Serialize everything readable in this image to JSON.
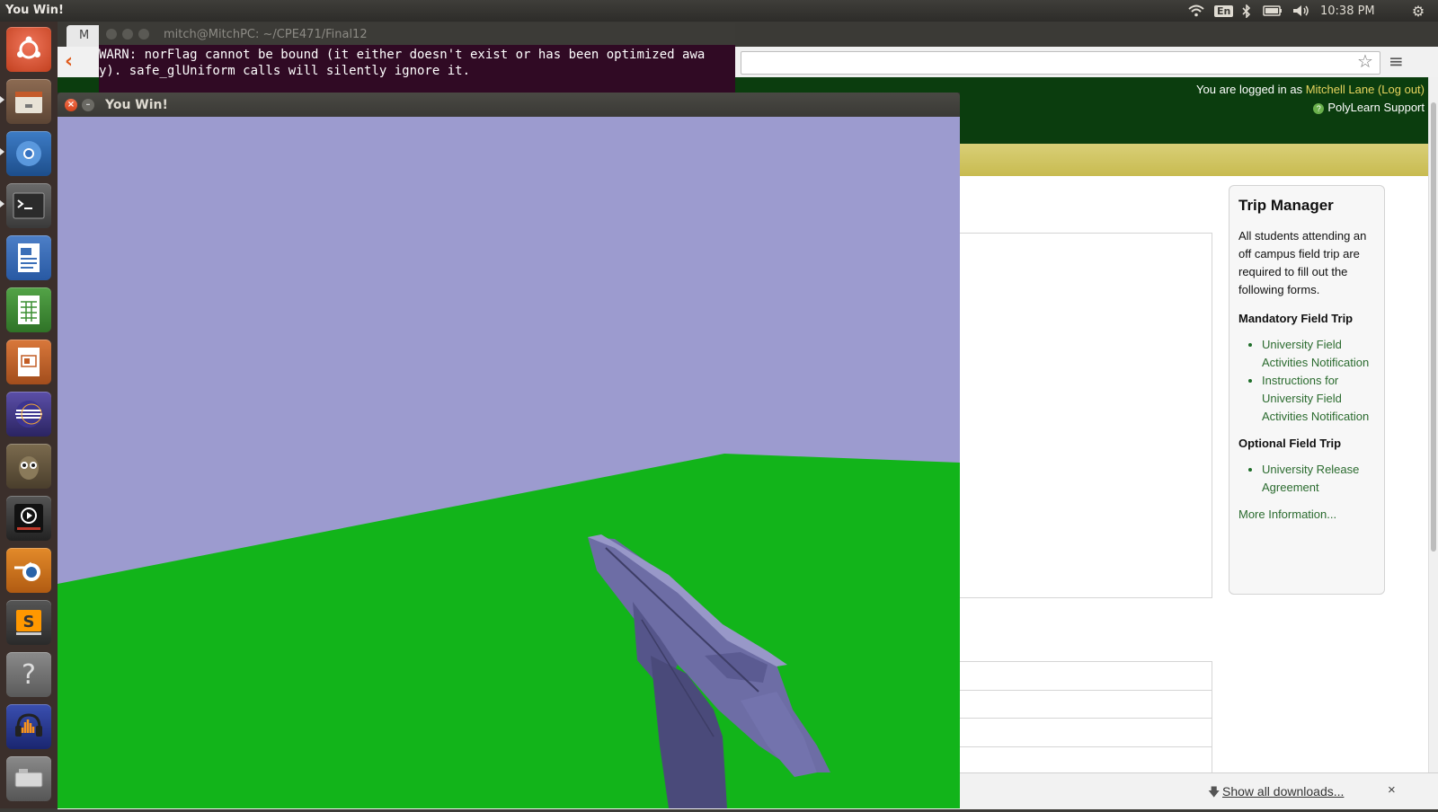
{
  "topbar": {
    "title": "You Win!",
    "language": "En",
    "time": "10:38 PM",
    "icons": [
      "wifi-icon",
      "bluetooth-icon",
      "battery-icon",
      "volume-icon",
      "gear-icon"
    ]
  },
  "launcher": {
    "items": [
      "ubuntu-dash",
      "files",
      "chromium",
      "terminal",
      "writer",
      "calc",
      "impress",
      "eclipse",
      "gimp",
      "video-player",
      "blender",
      "sublime-text",
      "help",
      "audacity",
      "removable-drive"
    ]
  },
  "terminal": {
    "title": "mitch@MitchPC: ~/CPE471/Final12",
    "line1": "WARN: norFlag cannot be bound (it either doesn't exist or has been optimized awa",
    "line2": "y). safe_glUniform calls will silently ignore it."
  },
  "game_window": {
    "title": "You Win!",
    "sky_color": "#9c9bcf",
    "ground_color": "#12b41a"
  },
  "browser": {
    "tab_label": "M",
    "login_prefix": "You are logged in as ",
    "user_name": "Mitchell Lane",
    "logout_label": "(Log out)",
    "support_label": "PolyLearn Support",
    "show_downloads": "Show all downloads...",
    "close_downloads": "×"
  },
  "trip_manager": {
    "heading": "Trip Manager",
    "intro": "All students attending an off campus field trip are required to fill out the following forms.",
    "mandatory_heading": "Mandatory Field Trip",
    "mandatory_links": [
      "University Field Activities Notification",
      "Instructions for University Field Activities Notification"
    ],
    "optional_heading": "Optional Field Trip",
    "optional_links": [
      "University Release Agreement"
    ],
    "more_link": "More Information..."
  }
}
